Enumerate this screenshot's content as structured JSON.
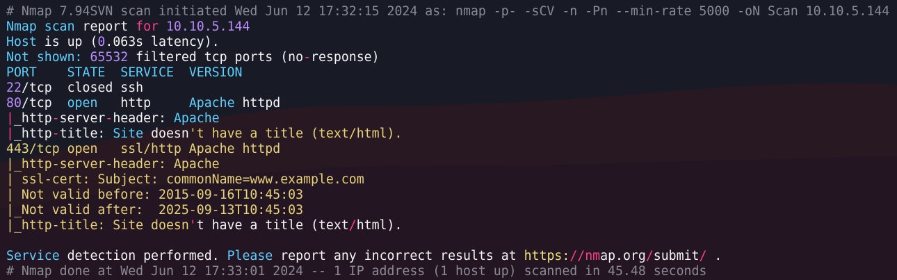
{
  "lines": [
    {
      "name": "comment-header-line",
      "segs": [
        {
          "t": "# Nmap 7.94SVN scan initiated Wed Jun 12 17:32:15 2024 as: nmap -p- -sCV -n -Pn --min-rate 5000 -oN Scan 10.10.5.144",
          "c": "comment"
        }
      ]
    },
    {
      "name": "scan-report-line",
      "segs": [
        {
          "t": "Nmap scan",
          "c": "cyan"
        },
        {
          "t": " report ",
          "c": "white"
        },
        {
          "t": "for",
          "c": "pink"
        },
        {
          "t": " ",
          "c": "white"
        },
        {
          "t": "10.10.5.144",
          "c": "purple"
        }
      ]
    },
    {
      "name": "host-status-line",
      "segs": [
        {
          "t": "Host",
          "c": "cyan"
        },
        {
          "t": " is up (",
          "c": "white"
        },
        {
          "t": "0",
          "c": "purple"
        },
        {
          "t": ".063s latency).",
          "c": "white"
        }
      ]
    },
    {
      "name": "not-shown-line",
      "segs": [
        {
          "t": "Not shown:",
          "c": "cyan"
        },
        {
          "t": " ",
          "c": "white"
        },
        {
          "t": "65532",
          "c": "purple"
        },
        {
          "t": " filtered tcp ports (no",
          "c": "white"
        },
        {
          "t": "-",
          "c": "pink"
        },
        {
          "t": "response)",
          "c": "white"
        }
      ]
    },
    {
      "name": "port-table-header",
      "segs": [
        {
          "t": "PORT    STATE  SERVICE  VERSION",
          "c": "cyan"
        }
      ]
    },
    {
      "name": "port-22-row",
      "segs": [
        {
          "t": "22",
          "c": "purple"
        },
        {
          "t": "/tcp  closed ssh",
          "c": "white"
        }
      ]
    },
    {
      "name": "port-80-row",
      "segs": [
        {
          "t": "80",
          "c": "purple"
        },
        {
          "t": "/tcp  ",
          "c": "white"
        },
        {
          "t": "open",
          "c": "cyan"
        },
        {
          "t": "   http     ",
          "c": "white"
        },
        {
          "t": "Apache",
          "c": "cyan"
        },
        {
          "t": " httpd",
          "c": "white"
        }
      ]
    },
    {
      "name": "port-80-server-header",
      "segs": [
        {
          "t": "|",
          "c": "pink"
        },
        {
          "t": "_http",
          "c": "white"
        },
        {
          "t": "-",
          "c": "pink"
        },
        {
          "t": "server",
          "c": "white"
        },
        {
          "t": "-",
          "c": "pink"
        },
        {
          "t": "header: ",
          "c": "white"
        },
        {
          "t": "Apache",
          "c": "cyan"
        }
      ]
    },
    {
      "name": "port-80-title",
      "segs": [
        {
          "t": "|",
          "c": "pink"
        },
        {
          "t": "_http",
          "c": "white"
        },
        {
          "t": "-",
          "c": "pink"
        },
        {
          "t": "title: ",
          "c": "white"
        },
        {
          "t": "Site",
          "c": "cyan"
        },
        {
          "t": " doesn",
          "c": "white"
        },
        {
          "t": "'t have a title (text/html).",
          "c": "yellow"
        }
      ]
    },
    {
      "name": "port-443-row",
      "segs": [
        {
          "t": "443/tcp open   ssl/http Apache httpd",
          "c": "yellow"
        }
      ]
    },
    {
      "name": "port-443-server-header",
      "segs": [
        {
          "t": "|_http-server-header: Apache",
          "c": "yellow"
        }
      ]
    },
    {
      "name": "port-443-ssl-cert",
      "segs": [
        {
          "t": "| ssl-cert: Subject: commonName=www.example.com",
          "c": "yellow"
        }
      ]
    },
    {
      "name": "port-443-not-before",
      "segs": [
        {
          "t": "| Not valid before: 2015-09-16T10:45:03",
          "c": "yellow"
        }
      ]
    },
    {
      "name": "port-443-not-after",
      "segs": [
        {
          "t": "|_Not valid after:  2025-09-13T10:45:03",
          "c": "yellow"
        }
      ]
    },
    {
      "name": "port-443-title",
      "segs": [
        {
          "t": "|_http-title: Site doesn",
          "c": "yellow"
        },
        {
          "t": "'",
          "c": "pink"
        },
        {
          "t": "t have a title (text",
          "c": "white"
        },
        {
          "t": "/",
          "c": "pink"
        },
        {
          "t": "html).",
          "c": "white"
        }
      ]
    },
    {
      "name": "blank-line",
      "segs": [
        {
          "t": " ",
          "c": "white"
        }
      ]
    },
    {
      "name": "service-detection-line",
      "segs": [
        {
          "t": "Service",
          "c": "cyan"
        },
        {
          "t": " detection performed. ",
          "c": "white"
        },
        {
          "t": "Please",
          "c": "cyan"
        },
        {
          "t": " report any incorrect results at ",
          "c": "white"
        },
        {
          "t": "https:",
          "c": "link"
        },
        {
          "t": "//",
          "c": "pink"
        },
        {
          "t": "nm",
          "c": "pink"
        },
        {
          "t": "ap.org",
          "c": "white"
        },
        {
          "t": "/",
          "c": "pink"
        },
        {
          "t": "submit",
          "c": "white"
        },
        {
          "t": "/",
          "c": "pink"
        },
        {
          "t": " .",
          "c": "white"
        }
      ]
    },
    {
      "name": "comment-footer-line",
      "segs": [
        {
          "t": "# Nmap done at Wed Jun 12 17:33:01 2024 -- 1 IP address (1 host up) scanned in 45.48 seconds",
          "c": "comment"
        }
      ]
    }
  ]
}
